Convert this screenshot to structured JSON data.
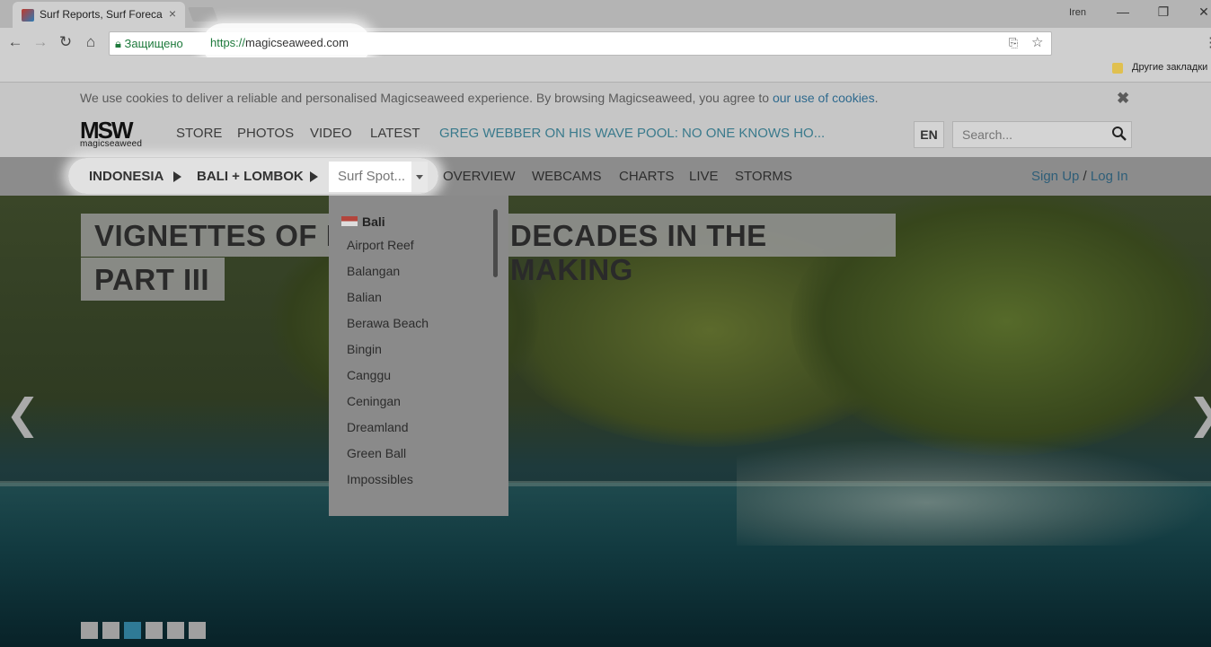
{
  "browser": {
    "tab_title": "Surf Reports, Surf Foreca",
    "tab_close": "×",
    "user": "Iren",
    "window_controls": [
      "—",
      "❐",
      "✕"
    ],
    "secure_label": "Защищено",
    "url_scheme": "https://",
    "url_host": "magicseaweed.com",
    "bookmarks_label": "Другие закладки"
  },
  "cookie_bar": {
    "text": "We use cookies to deliver a reliable and personalised Magicseaweed experience. By browsing Magicseaweed, you agree to ",
    "link": "our use of cookies",
    "suffix": ".",
    "close": "✖"
  },
  "header": {
    "logo_mark": "MSW",
    "logo_word": "magicseaweed",
    "nav": [
      "STORE",
      "PHOTOS",
      "VIDEO",
      "LATEST"
    ],
    "headline": "GREG WEBBER ON HIS WAVE POOL: NO ONE KNOWS HO...",
    "lang": "EN",
    "search_placeholder": "Search..."
  },
  "subnav": {
    "crumbs": [
      "INDONESIA",
      "BALI + LOMBOK"
    ],
    "spot_select": "Surf Spot...",
    "items": [
      "OVERVIEW",
      "WEBCAMS",
      "CHARTS",
      "LIVE",
      "STORMS"
    ],
    "sign_up": "Sign Up",
    "separator": "/",
    "log_in": "Log In"
  },
  "hero": {
    "title_line1": "VIGNETTES OF I",
    "title_line1b": "DECADES IN THE MAKING",
    "title_line2": "PART III",
    "prev": "❮",
    "next": "❯",
    "slides_total": 6,
    "active_slide": 3
  },
  "dropdown": {
    "group": "Bali",
    "items": [
      "Airport Reef",
      "Balangan",
      "Balian",
      "Berawa Beach",
      "Bingin",
      "Canggu",
      "Ceningan",
      "Dreamland",
      "Green Ball",
      "Impossibles"
    ]
  },
  "colors": {
    "link": "#2f6a8e",
    "headline": "#3a7a8c",
    "active_dot": "#2f7a96"
  }
}
